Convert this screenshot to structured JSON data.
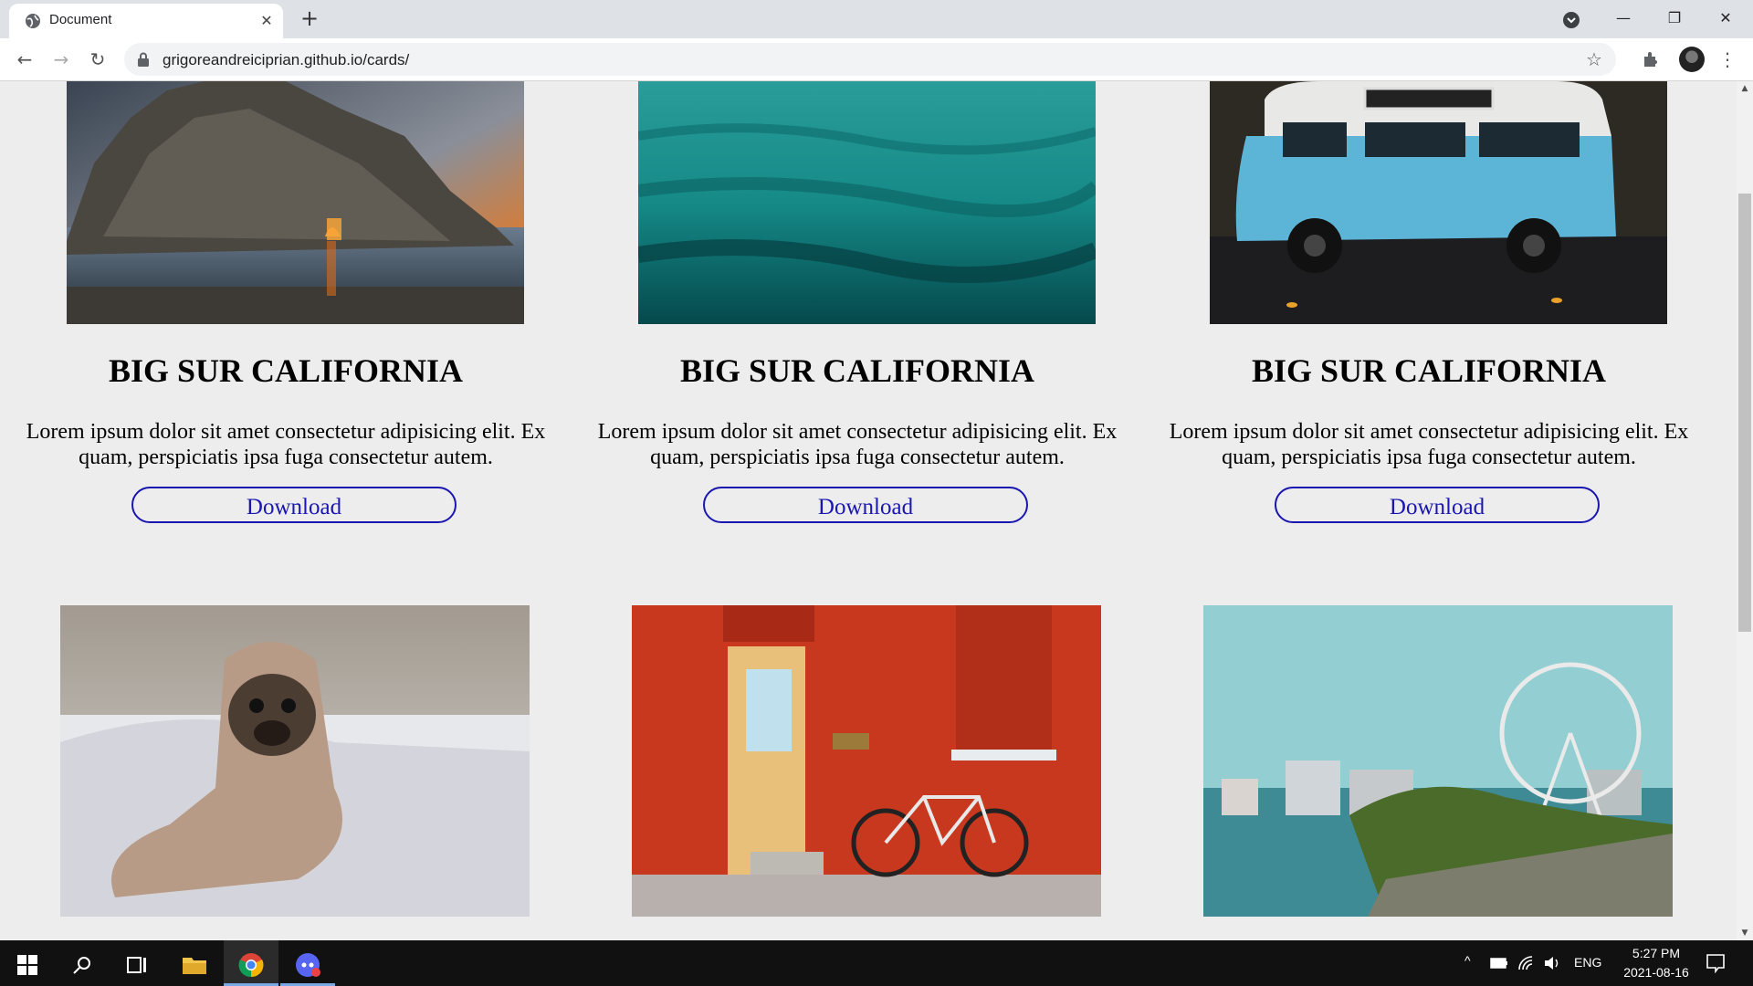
{
  "browser": {
    "tab_title": "Document",
    "tab_close": "✕",
    "new_tab": "+",
    "url": "grigoreandreiciprian.github.io/cards/",
    "back": "←",
    "forward": "→",
    "reload": "↻",
    "star": "☆",
    "menu": "⋮",
    "minimize": "—",
    "restore": "❐",
    "close": "✕"
  },
  "cards": [
    {
      "title": "BIG SUR CALIFORNIA",
      "text": "Lorem ipsum dolor sit amet consectetur adipisicing elit. Ex quam, perspiciatis ipsa fuga consectetur autem.",
      "button": "Download",
      "image": "coastal-rock-arch-sunset"
    },
    {
      "title": "BIG SUR CALIFORNIA",
      "text": "Lorem ipsum dolor sit amet consectetur adipisicing elit. Ex quam, perspiciatis ipsa fuga consectetur autem.",
      "button": "Download",
      "image": "teal-ocean-water"
    },
    {
      "title": "BIG SUR CALIFORNIA",
      "text": "Lorem ipsum dolor sit amet consectetur adipisicing elit. Ex quam, perspiciatis ipsa fuga consectetur autem.",
      "button": "Download",
      "image": "blue-vintage-van"
    },
    {
      "image": "pug-in-blanket"
    },
    {
      "image": "red-brick-wall-door-bicycle"
    },
    {
      "image": "waterfront-ferris-wheel"
    }
  ],
  "taskbar": {
    "time": "5:27 PM",
    "date": "2021-08-16",
    "language": "ENG"
  },
  "colors": {
    "page_background": "#ededed",
    "button_border": "#1a16b0"
  }
}
